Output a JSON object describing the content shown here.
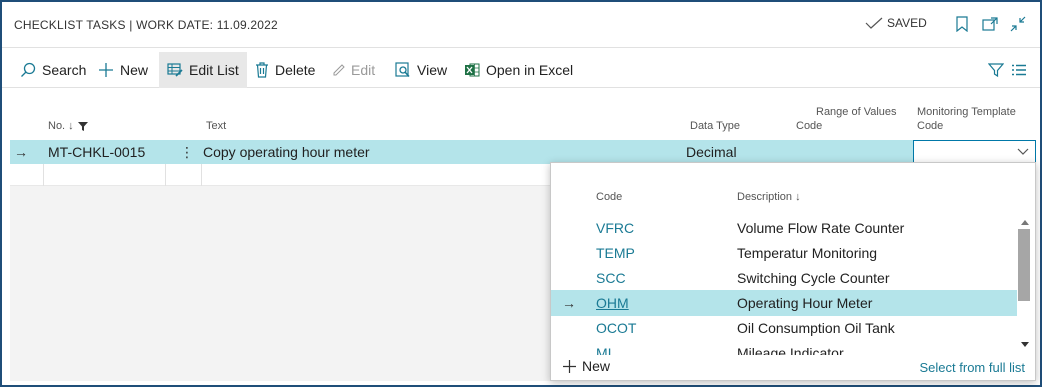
{
  "title": "CHECKLIST TASKS | WORK DATE: 11.09.2022",
  "status": "SAVED",
  "toolbar": {
    "search": "Search",
    "new": "New",
    "edit_list": "Edit List",
    "delete": "Delete",
    "edit": "Edit",
    "view": "View",
    "open_excel": "Open in Excel"
  },
  "columns": {
    "no": "No. ↓",
    "text": "Text",
    "data_type": "Data Type",
    "range1": "Range of Values",
    "range2": "Code",
    "template1": "Monitoring Template",
    "template2": "Code"
  },
  "row": {
    "no": "MT-CHKL-0015",
    "text": "Copy operating hour meter",
    "data_type": "Decimal",
    "template": ""
  },
  "lookup": {
    "col_code": "Code",
    "col_desc": "Description ↓",
    "items": [
      {
        "code": "VFRC",
        "desc": "Volume Flow Rate Counter"
      },
      {
        "code": "TEMP",
        "desc": "Temperatur Monitoring"
      },
      {
        "code": "SCC",
        "desc": "Switching Cycle Counter"
      },
      {
        "code": "OHM",
        "desc": "Operating Hour Meter"
      },
      {
        "code": "OCOT",
        "desc": "Oil Consumption Oil Tank"
      },
      {
        "code": "MI",
        "desc": "Mileage Indicator"
      }
    ],
    "new": "New",
    "select_full": "Select from full list"
  },
  "colors": {
    "accent": "#0078a8",
    "selected_row": "#b4e4ea",
    "link": "#1a7a94"
  }
}
